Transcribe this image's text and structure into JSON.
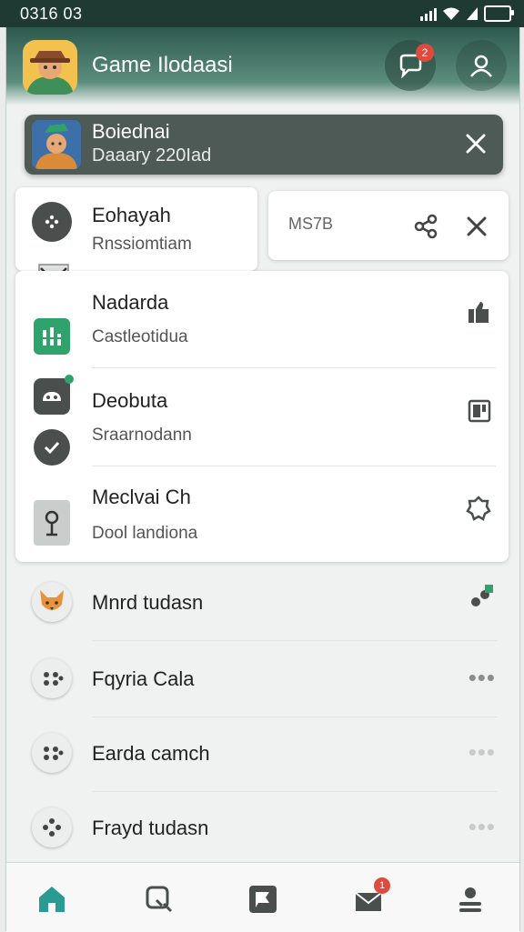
{
  "status_bar": {
    "time": "0316 03"
  },
  "header": {
    "title": "Game Ilodaasi",
    "notification_count": "2"
  },
  "banner": {
    "title": "Boiednai",
    "subtitle": "Daaary 220Iad"
  },
  "mini_card": {
    "code": "MS7B"
  },
  "card_items": [
    {
      "title": "Eohayah",
      "subtitle": "Rnssiomtiam"
    },
    {
      "title": "Nadarda",
      "subtitle": "Castleotidua"
    },
    {
      "title": "Deobuta",
      "subtitle": "Sraarnodann"
    },
    {
      "title": "Meclvai Ch",
      "subtitle": "Dool landiona"
    }
  ],
  "list_items": [
    {
      "title": "Mnrd tudasn"
    },
    {
      "title": "Fqyria Cala"
    },
    {
      "title": "Earda camch"
    },
    {
      "title": "Frayd tudasn"
    }
  ],
  "list_more_glyph": "•••",
  "bottom_nav": {
    "inbox_badge": "1"
  },
  "colors": {
    "header_top": "#2e5a4e",
    "accent_green": "#2fa36b",
    "badge_red": "#e04a3c",
    "banner_bg": "#4e5a56",
    "home_teal": "#2a9a93"
  },
  "icons": [
    "signal-icon",
    "wifi-icon",
    "battery-icon",
    "chat-icon",
    "profile-icon",
    "close-icon",
    "share-icon",
    "home-icon",
    "search-icon",
    "flag-icon",
    "mail-icon",
    "account-icon"
  ]
}
